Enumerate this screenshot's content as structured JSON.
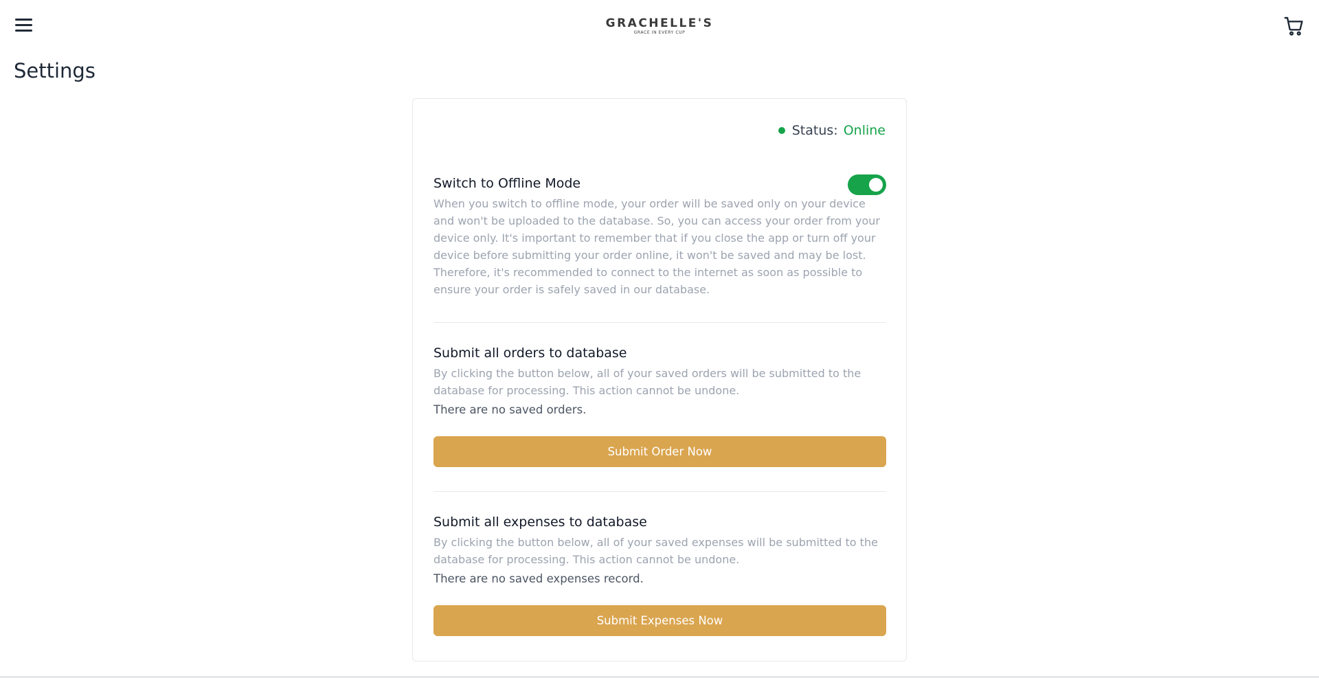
{
  "header": {
    "brand_name": "GRACHELLE'S",
    "brand_tagline": "GRACE IN EVERY CUP",
    "menu_icon": "hamburger-menu-icon",
    "cart_icon": "shopping-cart-icon"
  },
  "page": {
    "title": "Settings"
  },
  "status": {
    "label": "Status:",
    "value": "Online",
    "color": "#16a34a"
  },
  "offline_mode": {
    "title": "Switch to Offline Mode",
    "description": "When you switch to offline mode, your order will be saved only on your device and won't be uploaded to the database. So, you can access your order from your device only. It's important to remember that if you close the app or turn off your device before submitting your order online, it won't be saved and may be lost. Therefore, it's recommended to connect to the internet as soon as possible to ensure your order is safely saved in our database.",
    "toggle_on": true,
    "toggle_color": "#16a34a"
  },
  "orders": {
    "title": "Submit all orders to database",
    "description": "By clicking the button below, all of your saved orders will be submitted to the database for processing. This action cannot be undone.",
    "note": "There are no saved orders.",
    "button_label": "Submit Order Now"
  },
  "expenses": {
    "title": "Submit all expenses to database",
    "description": "By clicking the button below, all of your saved expenses will be submitted to the database for processing. This action cannot be undone.",
    "note": "There are no saved expenses record.",
    "button_label": "Submit Expenses Now"
  },
  "colors": {
    "accent": "#daa54f",
    "online": "#16a34a"
  }
}
